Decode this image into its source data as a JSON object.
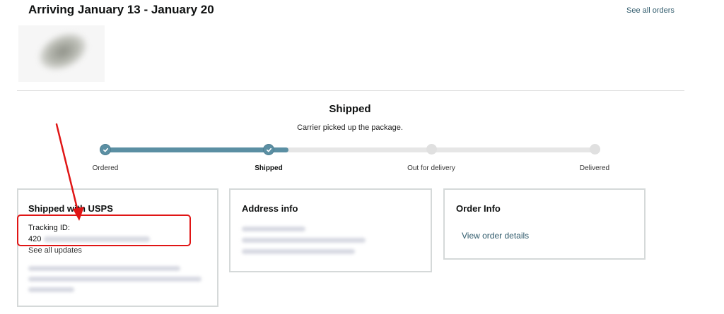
{
  "header": {
    "title": "Arriving January 13 - January 20",
    "see_all_orders": "See all orders"
  },
  "status": {
    "title": "Shipped",
    "subtitle": "Carrier picked up the package.",
    "progress_fraction": 0.375,
    "steps": [
      {
        "label": "Ordered",
        "state": "done"
      },
      {
        "label": "Shipped",
        "state": "current"
      },
      {
        "label": "Out for delivery",
        "state": "pending"
      },
      {
        "label": "Delivered",
        "state": "pending"
      }
    ]
  },
  "shipping_card": {
    "title": "Shipped with USPS",
    "tracking_label": "Tracking ID:",
    "tracking_number_prefix": "420",
    "see_all_updates": "See all updates"
  },
  "address_card": {
    "title": "Address info"
  },
  "order_card": {
    "title": "Order Info",
    "view_details": "View order details"
  },
  "colors": {
    "accent": "#5b8fa3",
    "link": "#2f5a6b",
    "annotation_red": "#e01515"
  }
}
